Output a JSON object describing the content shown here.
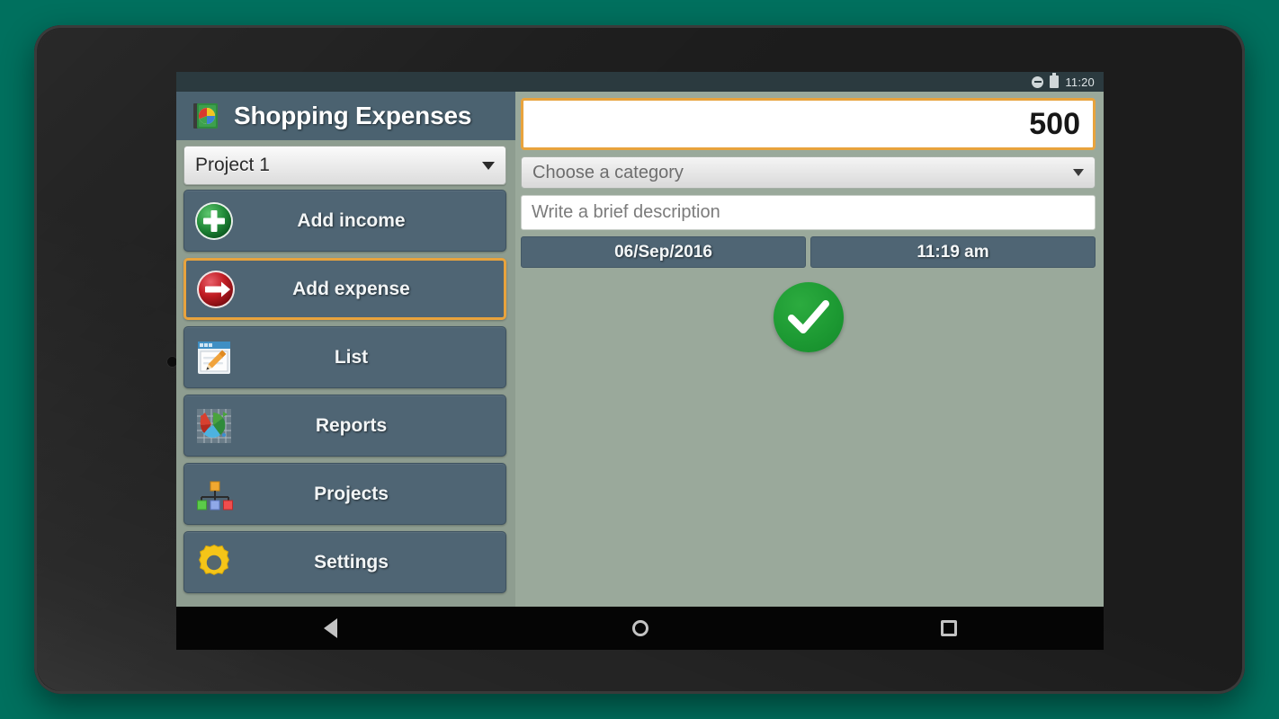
{
  "device": {
    "frame_color": "#1c1c1c",
    "background_color": "#00705e"
  },
  "statusbar": {
    "clock": "11:20",
    "dnd_icon": "do-not-disturb-icon",
    "battery_icon": "battery-full-icon"
  },
  "app": {
    "title": "Shopping Expenses",
    "icon": "app-book-chart-icon",
    "accent_color": "#e8a33d",
    "header_color": "#4b6270",
    "button_color": "#4f6574",
    "panel_color": "#9aa99b"
  },
  "project_selector": {
    "value": "Project 1",
    "caret_icon": "chevron-down-icon"
  },
  "nav": {
    "items": [
      {
        "label": "Add income",
        "icon": "add-income-icon",
        "selected": false
      },
      {
        "label": "Add expense",
        "icon": "add-expense-icon",
        "selected": true
      },
      {
        "label": "List",
        "icon": "list-notepad-icon",
        "selected": false
      },
      {
        "label": "Reports",
        "icon": "reports-chart-icon",
        "selected": false
      },
      {
        "label": "Projects",
        "icon": "projects-tree-icon",
        "selected": false
      },
      {
        "label": "Settings",
        "icon": "gear-icon",
        "selected": false
      }
    ]
  },
  "form": {
    "amount_value": "500",
    "amount_placeholder": "",
    "category_placeholder": "Choose a category",
    "description_placeholder": "Write a brief description",
    "description_value": "",
    "date": "06/Sep/2016",
    "time": "11:19 am",
    "confirm_icon": "checkmark-icon"
  },
  "navbar": {
    "back": "back-triangle-icon",
    "home": "home-circle-icon",
    "recents": "recents-square-icon"
  }
}
